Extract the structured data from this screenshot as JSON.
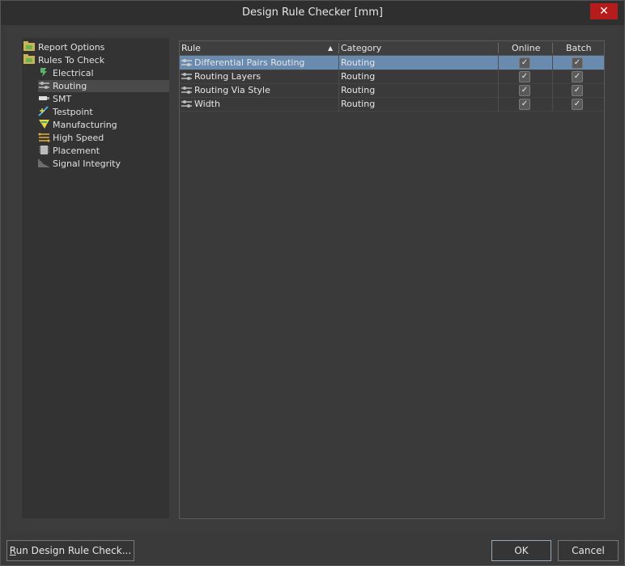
{
  "window": {
    "title": "Design Rule Checker [mm]",
    "close_label": "✕"
  },
  "tree": {
    "items": [
      {
        "label": "Report Options",
        "icon": "folder-icon"
      },
      {
        "label": "Rules To Check",
        "icon": "folder-icon"
      },
      {
        "label": "Electrical",
        "icon": "electrical-icon"
      },
      {
        "label": "Routing",
        "icon": "routing-icon",
        "selected": true
      },
      {
        "label": "SMT",
        "icon": "smt-icon"
      },
      {
        "label": "Testpoint",
        "icon": "testpoint-icon"
      },
      {
        "label": "Manufacturing",
        "icon": "manufacturing-icon"
      },
      {
        "label": "High Speed",
        "icon": "high-speed-icon"
      },
      {
        "label": "Placement",
        "icon": "placement-icon"
      },
      {
        "label": "Signal Integrity",
        "icon": "signal-integrity-icon"
      }
    ]
  },
  "grid": {
    "columns": {
      "rule": "Rule",
      "category": "Category",
      "online": "Online",
      "batch": "Batch"
    },
    "rows": [
      {
        "rule": "Differential Pairs Routing",
        "category": "Routing",
        "online": true,
        "batch": true,
        "selected": true
      },
      {
        "rule": "Routing Layers",
        "category": "Routing",
        "online": true,
        "batch": true
      },
      {
        "rule": "Routing Via Style",
        "category": "Routing",
        "online": true,
        "batch": true
      },
      {
        "rule": "Width",
        "category": "Routing",
        "online": true,
        "batch": true
      }
    ]
  },
  "footer": {
    "run_first_letter": "R",
    "run_rest": "un Design Rule Check...",
    "ok": "OK",
    "cancel": "Cancel"
  }
}
